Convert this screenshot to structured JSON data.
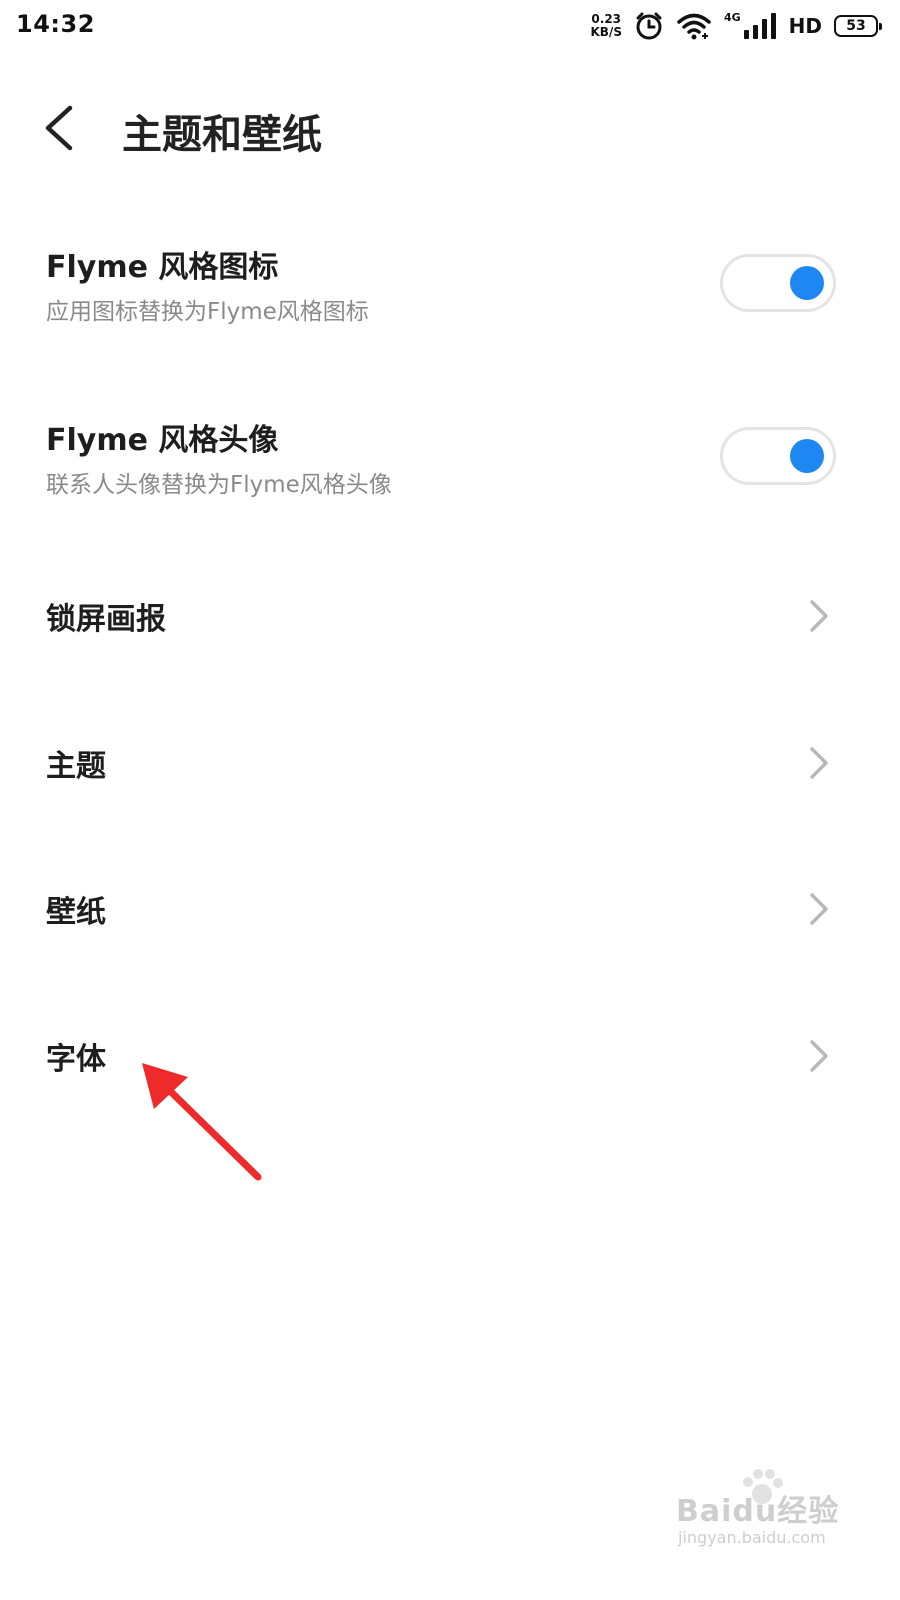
{
  "status_bar": {
    "time": "14:32",
    "net_speed_value": "0.23",
    "net_speed_unit": "KB/S",
    "network_type": "4G",
    "hd_label": "HD",
    "battery_level": "53",
    "icons": [
      "alarm-icon",
      "wifi-icon",
      "cellular-signal-icon",
      "battery-icon"
    ]
  },
  "header": {
    "title": "主题和壁纸",
    "back_icon": "chevron-left-icon"
  },
  "settings": {
    "flyme_icons": {
      "title": "Flyme 风格图标",
      "subtitle": "应用图标替换为Flyme风格图标",
      "enabled": true
    },
    "flyme_avatar": {
      "title": "Flyme 风格头像",
      "subtitle": "联系人头像替换为Flyme风格头像",
      "enabled": true
    },
    "lock_screen": {
      "title": "锁屏画报"
    },
    "theme": {
      "title": "主题"
    },
    "wallpaper": {
      "title": "壁纸"
    },
    "font": {
      "title": "字体"
    }
  },
  "colors": {
    "toggle_on": "#1f87f2",
    "annotation_arrow": "#ee2a2a"
  },
  "watermark": {
    "brand": "Baidu经验",
    "url": "jingyan.baidu.com"
  }
}
